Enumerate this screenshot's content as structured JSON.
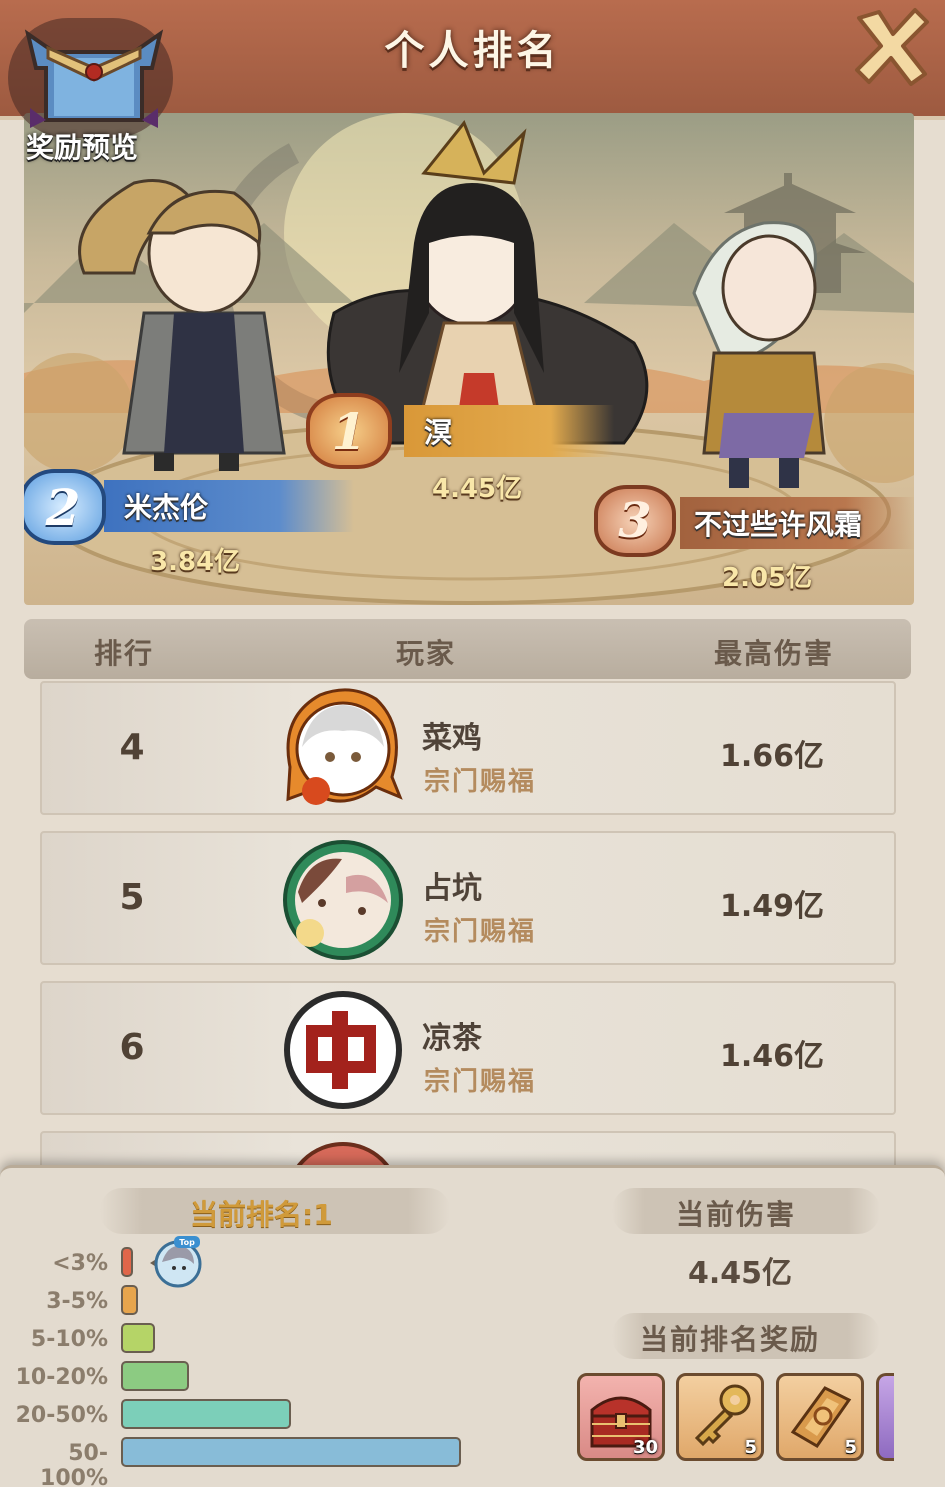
{
  "header": {
    "title": "个人排名"
  },
  "reward_preview": {
    "label": "奖励预览"
  },
  "podium": {
    "first": {
      "rank": "1",
      "name": "溟",
      "damage": "4.45亿"
    },
    "second": {
      "rank": "2",
      "name": "米杰伦",
      "damage": "3.84亿"
    },
    "third": {
      "rank": "3",
      "name": "不过些许风霜",
      "damage": "2.05亿"
    }
  },
  "table": {
    "headers": {
      "rank": "排行",
      "player": "玩家",
      "damage": "最高伤害"
    },
    "rows": [
      {
        "rank": "4",
        "name": "菜鸡",
        "guild": "宗门赐福",
        "damage": "1.66亿"
      },
      {
        "rank": "5",
        "name": "占坑",
        "guild": "宗门赐福",
        "damage": "1.49亿"
      },
      {
        "rank": "6",
        "name": "凉茶",
        "guild": "宗门赐福",
        "damage": "1.46亿"
      }
    ]
  },
  "bottom": {
    "current_rank_label": "当前排名:1",
    "tiers": [
      {
        "label": "<3%",
        "color": "#e0664a",
        "fill": 0.03
      },
      {
        "label": "3-5%",
        "color": "#e7a54d",
        "fill": 0.05
      },
      {
        "label": "5-10%",
        "color": "#b5d467",
        "fill": 0.1
      },
      {
        "label": "10-20%",
        "color": "#8ccb82",
        "fill": 0.2
      },
      {
        "label": "20-50%",
        "color": "#7ccfb9",
        "fill": 0.5
      },
      {
        "label": "50-100%",
        "color": "#88bcd8",
        "fill": 1.0
      }
    ],
    "self_badge": "Top",
    "current_damage_title": "当前伤害",
    "current_damage": "4.45亿",
    "current_reward_title": "当前排名奖励",
    "rewards": [
      {
        "icon": "treasure-chest-icon",
        "count": "30"
      },
      {
        "icon": "golden-key-icon",
        "count": "5"
      },
      {
        "icon": "scroll-ticket-icon",
        "count": "5"
      }
    ]
  }
}
